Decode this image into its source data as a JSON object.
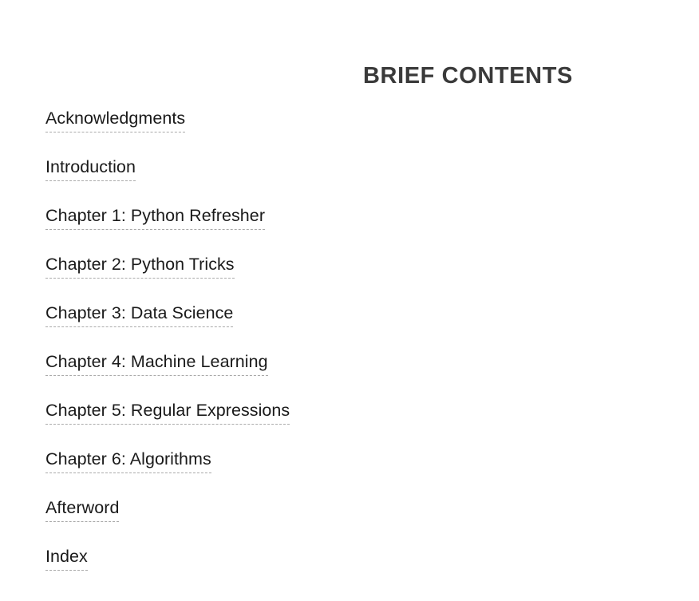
{
  "document": {
    "title": "BRIEF CONTENTS",
    "background_color": "#ffffff",
    "title_color": "#3a3a3a",
    "entry_color": "#1a1a1a",
    "underline_color": "#aaaaaa"
  },
  "contents": {
    "entries": [
      {
        "label": "Acknowledgments"
      },
      {
        "label": "Introduction"
      },
      {
        "label": "Chapter 1: Python Refresher"
      },
      {
        "label": "Chapter 2: Python Tricks"
      },
      {
        "label": "Chapter 3: Data Science"
      },
      {
        "label": "Chapter 4: Machine Learning"
      },
      {
        "label": "Chapter 5: Regular Expressions"
      },
      {
        "label": "Chapter 6: Algorithms"
      },
      {
        "label": "Afterword"
      },
      {
        "label": "Index"
      }
    ]
  }
}
